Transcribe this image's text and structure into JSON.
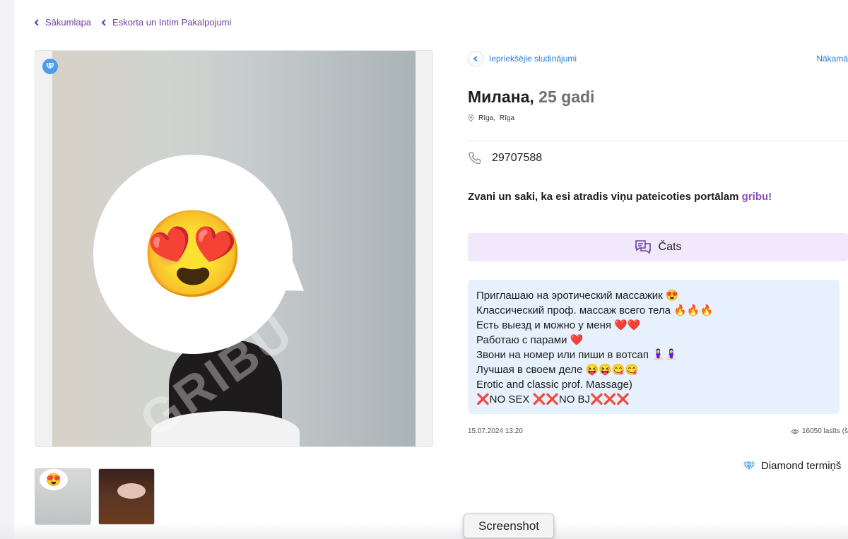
{
  "breadcrumb": {
    "items": [
      {
        "label": "Sākumlapa"
      },
      {
        "label": "Eskorta un Intim Pakalpojumi"
      }
    ]
  },
  "gallery": {
    "badge_icon": "diamond-icon",
    "overlay_emoji": "😍",
    "watermark": "GRIBU",
    "thumbnail_count": 2
  },
  "navigation": {
    "prev_label": "Iepriekšējie sludinājumi",
    "next_label": "Nākamā"
  },
  "listing": {
    "name": "Милана,",
    "age": "25 gadi",
    "location_city": "Rīga",
    "location_sep": ",",
    "location_region": "Rīga",
    "phone": "29707588",
    "cta_text": "Zvani un saki, ka esi atradis viņu pateicoties portālam",
    "cta_brand": "gribu!",
    "chat_label": "Čats",
    "description": [
      "Приглашаю на эротический массажик 😍",
      "Классический проф. массаж всего тела 🔥🔥🔥",
      "Есть выезд и можно у меня ❤️❤️",
      "Работаю с парами ❤️",
      "Звони на номер или пиши в вотсап 🧘🏻‍♀️🧘🏻‍♀️",
      "Лучшая в своем деле 😝😝😋😋",
      "Erotic and classic prof. Massage)",
      "❌NO SEX ❌❌NO BJ❌❌❌"
    ],
    "date": "15.07.2024 13:20",
    "views": "16050 lasīts (š",
    "diamond_terms": "Diamond termiņš"
  },
  "screenshot_button": "Screenshot",
  "colors": {
    "accent_purple": "#6b3fa0",
    "link_blue": "#2a7cd6",
    "brand_purple": "#8b4fc4",
    "chat_bg": "#f1e9fb",
    "desc_bg": "#e6f1fd"
  }
}
